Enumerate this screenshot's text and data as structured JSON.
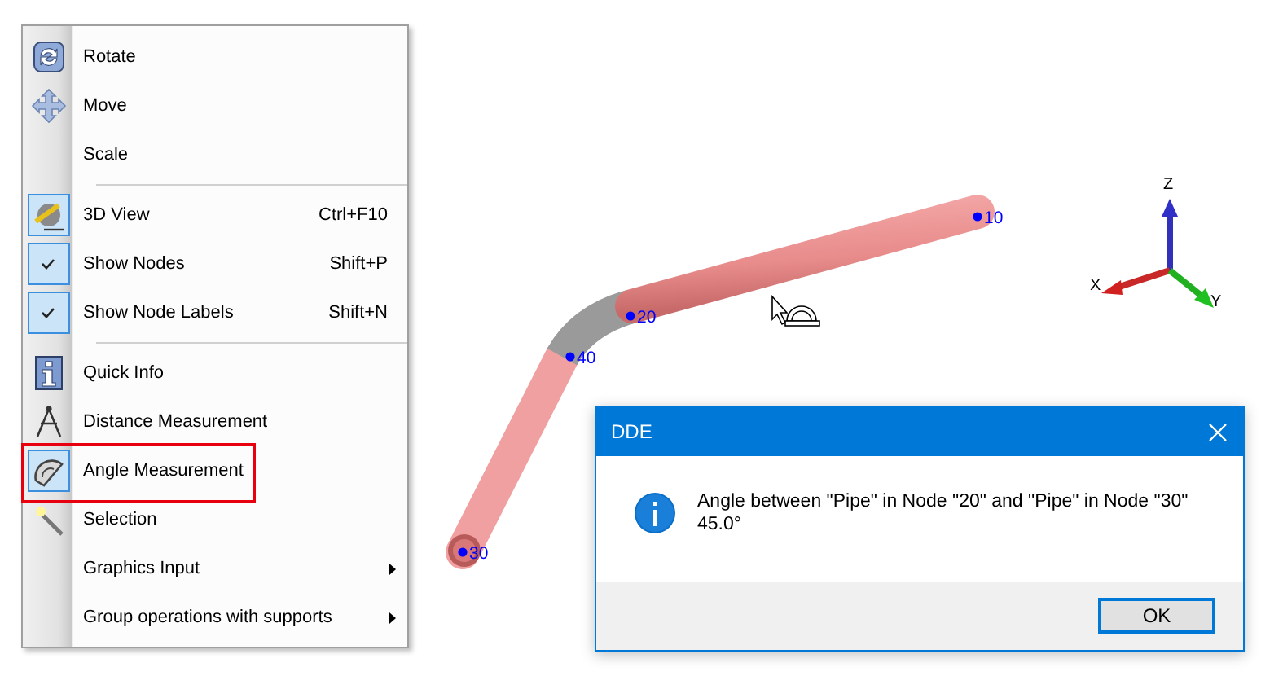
{
  "menu": {
    "items": [
      {
        "kind": "command",
        "label": "Rotate",
        "checked": false,
        "outlined": false
      },
      {
        "kind": "command",
        "label": "Move",
        "checked": false,
        "outlined": false
      },
      {
        "kind": "command",
        "label": "Scale",
        "checked": false,
        "outlined": false
      },
      {
        "kind": "separator"
      },
      {
        "kind": "command",
        "label": "3D View",
        "shortcut": "Ctrl+F10",
        "checked": true,
        "outlined": false
      },
      {
        "kind": "check",
        "label": "Show Nodes",
        "shortcut": "Shift+P",
        "checked": true,
        "outlined": false
      },
      {
        "kind": "check",
        "label": "Show Node Labels",
        "shortcut": "Shift+N",
        "checked": true,
        "outlined": false
      },
      {
        "kind": "separator"
      },
      {
        "kind": "command",
        "label": "Quick Info",
        "checked": false,
        "outlined": false
      },
      {
        "kind": "command",
        "label": "Distance Measurement",
        "checked": false,
        "outlined": false
      },
      {
        "kind": "command",
        "label": "Angle Measurement",
        "checked": true,
        "outlined": true
      },
      {
        "kind": "command",
        "label": "Selection",
        "checked": false,
        "outlined": false
      },
      {
        "kind": "submenu",
        "label": "Graphics Input",
        "checked": false,
        "outlined": false
      },
      {
        "kind": "submenu",
        "label": "Group operations with supports",
        "checked": false,
        "outlined": false
      }
    ]
  },
  "scene": {
    "nodes": [
      {
        "label": "10"
      },
      {
        "label": "20"
      },
      {
        "label": "40"
      },
      {
        "label": "30"
      }
    ],
    "axes": [
      {
        "label": "Z"
      },
      {
        "label": "X"
      },
      {
        "label": "Y"
      }
    ]
  },
  "dialog": {
    "title": "DDE",
    "lines": [
      "Angle between \"Pipe\" in Node \"20\" and \"Pipe\" in Node \"30\"",
      "45.0°"
    ],
    "button": "OK"
  }
}
